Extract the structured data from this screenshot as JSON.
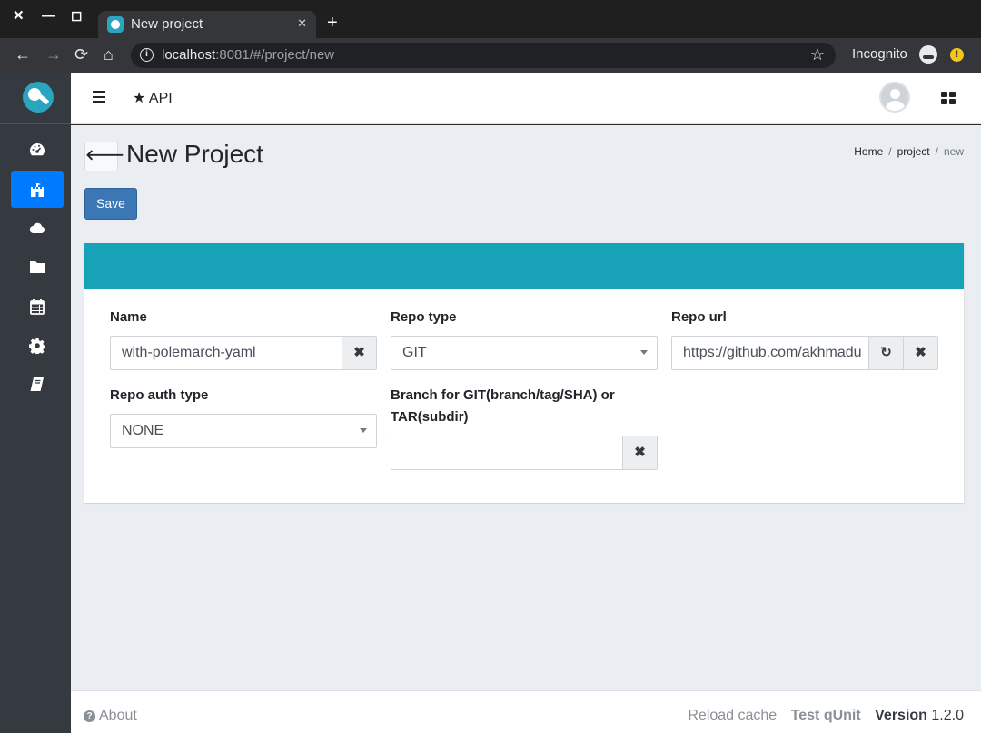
{
  "browser": {
    "tab_title": "New project",
    "tab_close": "✕",
    "new_tab": "+",
    "window_close": "✕",
    "window_min": "—",
    "window_max": "◻",
    "url_host": "localhost",
    "url_rest": ":8081/#/project/new",
    "incognito_label": "Incognito",
    "alert": "!"
  },
  "header": {
    "api_label": "API"
  },
  "page": {
    "back_glyph": "🡐",
    "title": "New Project",
    "breadcrumb": [
      "Home",
      "project",
      "new"
    ],
    "save_label": "Save"
  },
  "form": {
    "name": {
      "label": "Name",
      "value": "with-polemarch-yaml"
    },
    "repo_type": {
      "label": "Repo type",
      "value": "GIT"
    },
    "repo_url": {
      "label": "Repo url",
      "value": "https://github.com/akhmadu"
    },
    "repo_auth_type": {
      "label": "Repo auth type",
      "value": "NONE"
    },
    "branch": {
      "label_line1": "Branch for GIT(branch/tag/SHA) or",
      "label_line2": "TAR(subdir)",
      "value": ""
    },
    "clear_glyph": "✖",
    "reload_glyph": "↻"
  },
  "footer": {
    "about": "About",
    "reload_cache": "Reload cache",
    "test_qunit": "Test qUnit",
    "version_label": "Version",
    "version_value": "1.2.0"
  },
  "colors": {
    "sidebar_bg": "#343a40",
    "active_blue": "#007bff",
    "card_header_teal": "#18a2b8",
    "save_blue": "#3c77b5"
  }
}
